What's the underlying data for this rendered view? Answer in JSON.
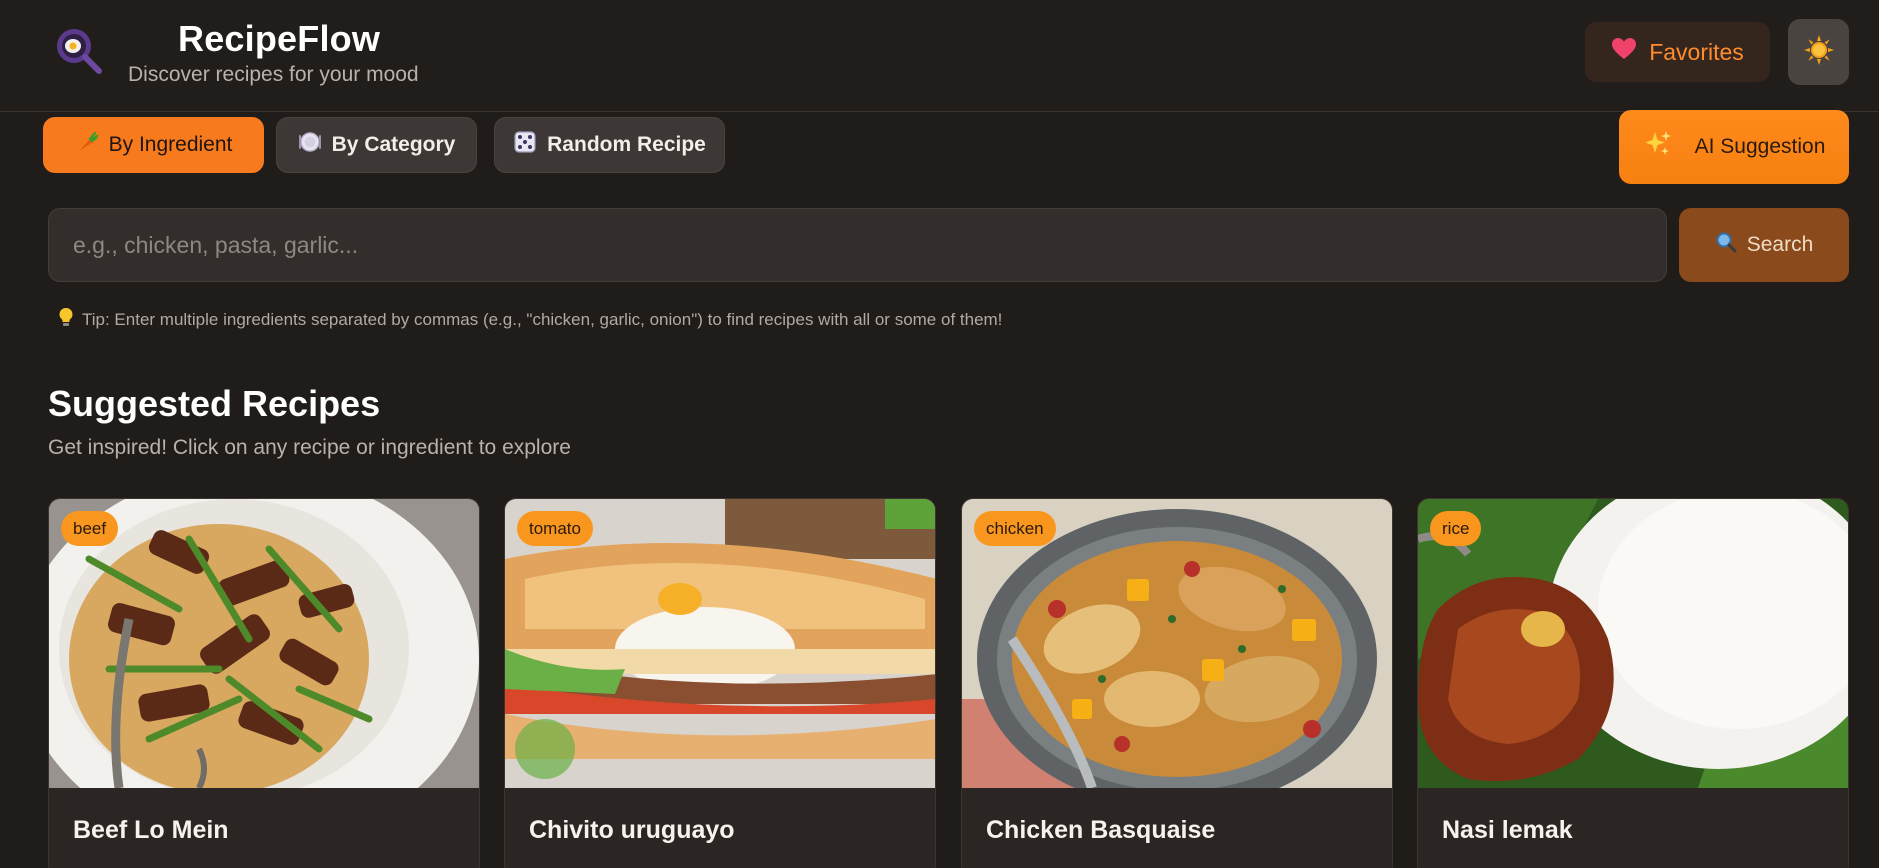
{
  "header": {
    "title": "RecipeFlow",
    "subtitle": "Discover recipes for your mood",
    "favorites_label": "Favorites",
    "logo_icon": "frying-pan-egg-icon",
    "theme_icon": "sun-icon"
  },
  "tabs": [
    {
      "label": "By Ingredient",
      "icon": "carrot-icon",
      "active": true
    },
    {
      "label": "By Category",
      "icon": "plate-icon",
      "active": false
    },
    {
      "label": "Random Recipe",
      "icon": "dice-icon",
      "active": false
    }
  ],
  "ai_button": {
    "label": "AI Suggestion",
    "icon": "sparkles-icon"
  },
  "search": {
    "placeholder": "e.g., chicken, pasta, garlic...",
    "value": "",
    "button_label": "Search",
    "button_icon": "magnifier-icon"
  },
  "tip": "Tip: Enter multiple ingredients separated by commas (e.g., \"chicken, garlic, onion\") to find recipes with all or some of them!",
  "section": {
    "title": "Suggested Recipes",
    "subtitle": "Get inspired! Click on any recipe or ingredient to explore"
  },
  "recipes": [
    {
      "tag": "beef",
      "title": "Beef Lo Mein"
    },
    {
      "tag": "tomato",
      "title": "Chivito uruguayo"
    },
    {
      "tag": "chicken",
      "title": "Chicken Basquaise"
    },
    {
      "tag": "rice",
      "title": "Nasi lemak"
    }
  ],
  "colors": {
    "accent": "#f77a1c",
    "background": "#201c1a",
    "tag": "#f9961e"
  }
}
